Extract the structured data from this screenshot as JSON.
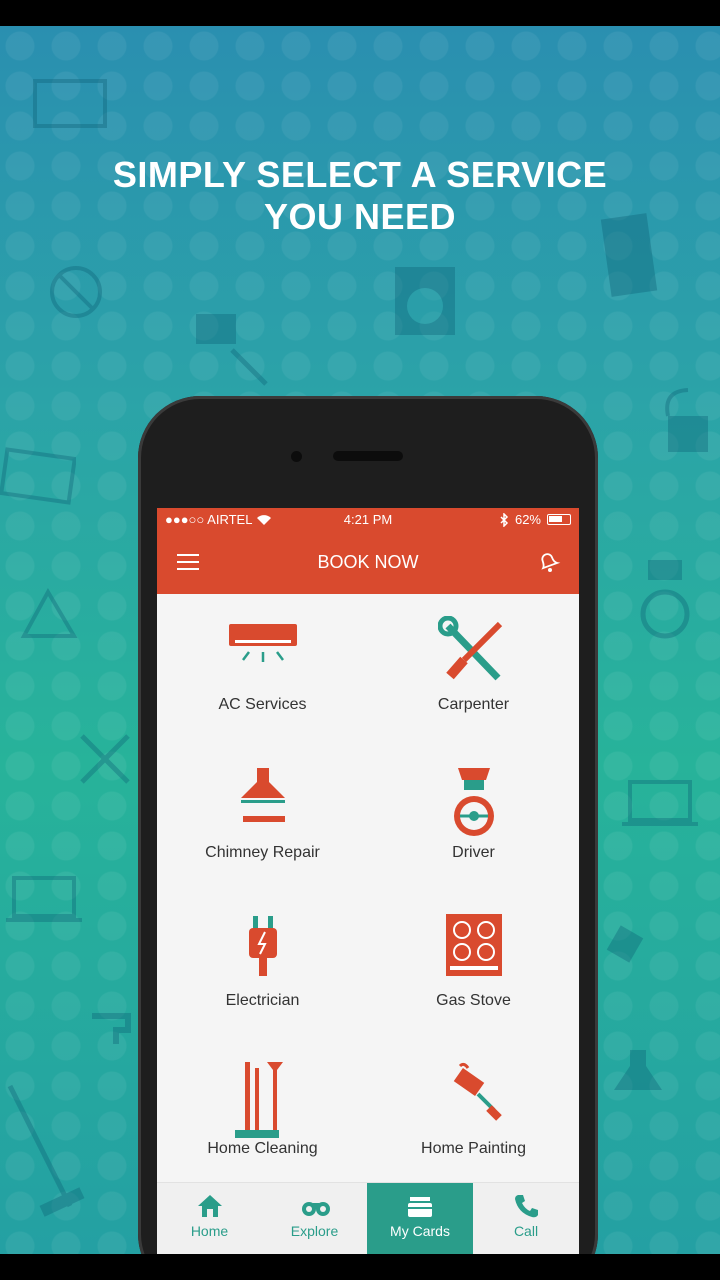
{
  "headline": {
    "line1": "SIMPLY SELECT A SERVICE",
    "line2": "YOU NEED"
  },
  "status_bar": {
    "carrier": "●●●○○ AIRTEL",
    "time": "4:21 PM",
    "battery": "62%"
  },
  "header": {
    "title": "BOOK NOW"
  },
  "services": [
    {
      "label": "AC Services",
      "icon": "ac-icon"
    },
    {
      "label": "Carpenter",
      "icon": "tools-icon"
    },
    {
      "label": "Chimney Repair",
      "icon": "chimney-icon"
    },
    {
      "label": "Driver",
      "icon": "driver-icon"
    },
    {
      "label": "Electrician",
      "icon": "plug-icon"
    },
    {
      "label": "Gas Stove",
      "icon": "stove-icon"
    },
    {
      "label": "Home Cleaning",
      "icon": "broom-icon"
    },
    {
      "label": "Home Painting",
      "icon": "paint-roller-icon"
    }
  ],
  "tabs": [
    {
      "label": "Home",
      "icon": "home-icon",
      "active": false
    },
    {
      "label": "Explore",
      "icon": "binoculars-icon",
      "active": false
    },
    {
      "label": "My Cards",
      "icon": "cards-icon",
      "active": true
    },
    {
      "label": "Call",
      "icon": "phone-icon",
      "active": false
    }
  ],
  "colors": {
    "brand_red": "#d94a2e",
    "accent_teal": "#2a9d8a",
    "icon_red": "#d94a2e",
    "icon_teal": "#2a9d8a"
  }
}
